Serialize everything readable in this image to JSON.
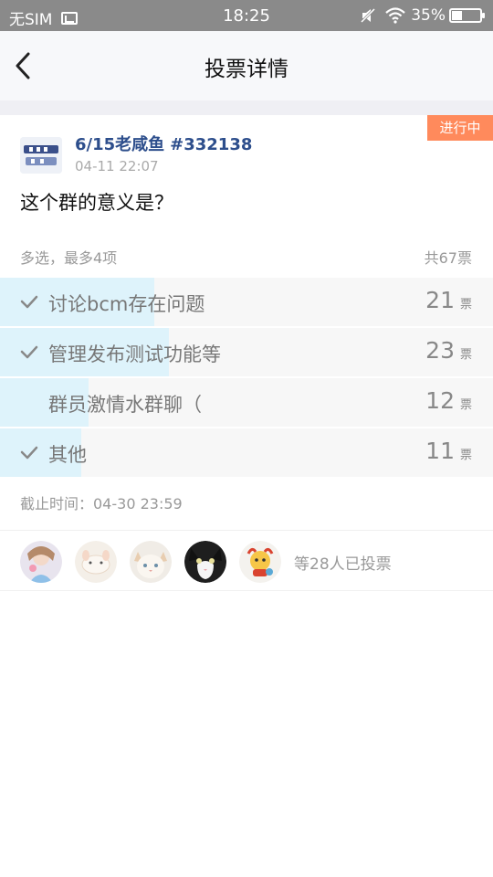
{
  "status_bar": {
    "carrier": "无SIM",
    "time": "18:25",
    "battery": "35%",
    "battery_level": 0.35
  },
  "header": {
    "title": "投票详情",
    "back_icon": "chevron-left-icon"
  },
  "poll": {
    "status": "进行中",
    "author": "6/15老咸鱼",
    "group_id": "#332138",
    "time": "04-11 22:07",
    "question": "这个群的意义是？",
    "mode": "多选，最多4项",
    "total": "共67票",
    "unit": "票",
    "options": [
      {
        "label": "讨论bcm存在问题",
        "count": "21",
        "checked": true,
        "fraction": 0.313
      },
      {
        "label": "管理发布测试功能等",
        "count": "23",
        "checked": true,
        "fraction": 0.343
      },
      {
        "label": "群员激情水群聊（",
        "count": "12",
        "checked": false,
        "fraction": 0.179
      },
      {
        "label": "其他",
        "count": "11",
        "checked": true,
        "fraction": 0.164
      }
    ],
    "deadline": "截止时间：04-30 23:59",
    "voter_summary": "等28人已投票"
  },
  "colors": {
    "accent": "#2d4e8c",
    "status_tag": "#ff8a5c",
    "bar_fill": "#def3fb"
  }
}
